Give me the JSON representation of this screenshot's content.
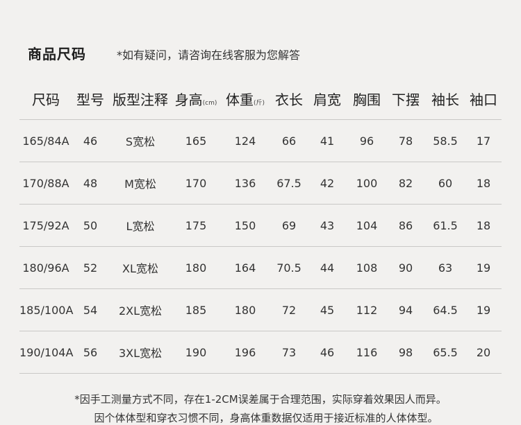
{
  "header": {
    "title": "商品尺码",
    "note": "*如有疑问，请咨询在线客服为您解答"
  },
  "table": {
    "columns": [
      {
        "label": "尺码",
        "unit": ""
      },
      {
        "label": "型号",
        "unit": ""
      },
      {
        "label": "版型注释",
        "unit": ""
      },
      {
        "label": "身高",
        "unit": "(cm)"
      },
      {
        "label": "体重",
        "unit": "(斤)"
      },
      {
        "label": "衣长",
        "unit": ""
      },
      {
        "label": "肩宽",
        "unit": ""
      },
      {
        "label": "胸围",
        "unit": ""
      },
      {
        "label": "下摆",
        "unit": ""
      },
      {
        "label": "袖长",
        "unit": ""
      },
      {
        "label": "袖口",
        "unit": ""
      }
    ],
    "rows": [
      [
        "165/84A",
        "46",
        "S宽松",
        "165",
        "124",
        "66",
        "41",
        "96",
        "78",
        "58.5",
        "17"
      ],
      [
        "170/88A",
        "48",
        "M宽松",
        "170",
        "136",
        "67.5",
        "42",
        "100",
        "82",
        "60",
        "18"
      ],
      [
        "175/92A",
        "50",
        "L宽松",
        "175",
        "150",
        "69",
        "43",
        "104",
        "86",
        "61.5",
        "18"
      ],
      [
        "180/96A",
        "52",
        "XL宽松",
        "180",
        "164",
        "70.5",
        "44",
        "108",
        "90",
        "63",
        "19"
      ],
      [
        "185/100A",
        "54",
        "2XL宽松",
        "185",
        "180",
        "72",
        "45",
        "112",
        "94",
        "64.5",
        "19"
      ],
      [
        "190/104A",
        "56",
        "3XL宽松",
        "190",
        "196",
        "73",
        "46",
        "116",
        "98",
        "65.5",
        "20"
      ]
    ]
  },
  "footer": {
    "line1": "*因手工测量方式不同，存在1-2CM误差属于合理范围，实际穿着效果因人而异。",
    "line2": "因个体体型和穿衣习惯不同，身高体重数据仅适用于接近标准的人体体型。"
  }
}
